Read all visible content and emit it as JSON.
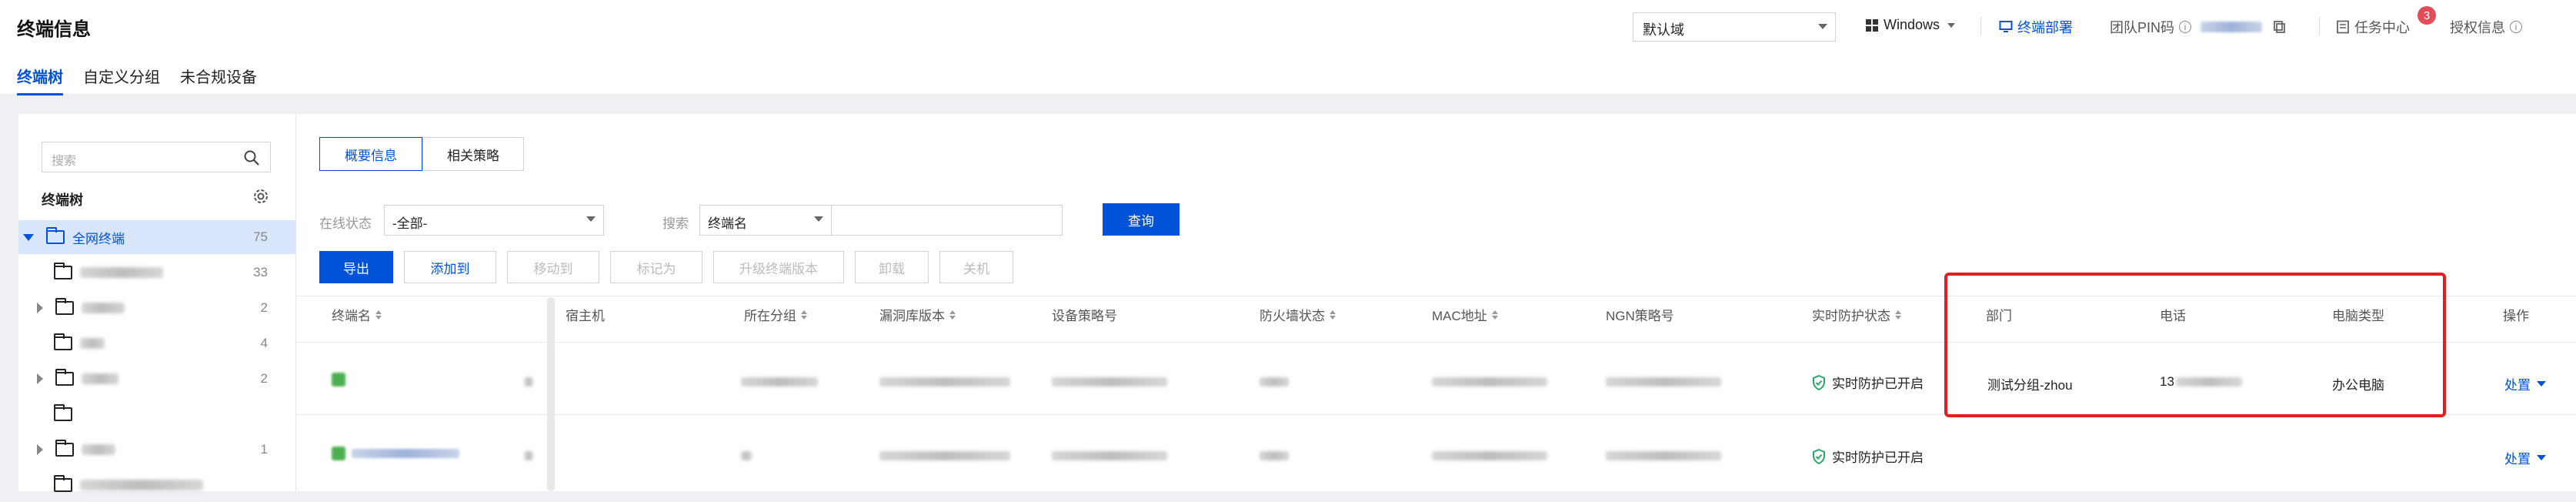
{
  "header": {
    "title": "终端信息",
    "tabs": [
      {
        "label": "终端树",
        "active": true
      },
      {
        "label": "自定义分组",
        "active": false
      },
      {
        "label": "未合规设备",
        "active": false
      }
    ],
    "domain_select": "默认域",
    "os_select": "Windows",
    "deploy": "终端部署",
    "team_pin_label": "团队PIN码",
    "task_center": "任务中心",
    "task_badge": "3",
    "license": "授权信息"
  },
  "sidebar": {
    "search_placeholder": "搜索",
    "tree_title": "终端树",
    "items": [
      {
        "label": "全网终端",
        "count": "75"
      },
      {
        "label": "",
        "count": "33"
      },
      {
        "label": "",
        "count": "2"
      },
      {
        "label": "",
        "count": "4"
      },
      {
        "label": "",
        "count": "2"
      },
      {
        "label": "",
        "count": ""
      },
      {
        "label": "",
        "count": "1"
      }
    ]
  },
  "main": {
    "segments": [
      "概要信息",
      "相关策略"
    ],
    "filter": {
      "status_label": "在线状态",
      "status_value": "-全部-",
      "search_label": "搜索",
      "search_field": "终端名",
      "query_button": "查询"
    },
    "actions": [
      "导出",
      "添加到",
      "移动到",
      "标记为",
      "升级终端版本",
      "卸载",
      "关机"
    ],
    "columns": [
      "终端名",
      "宿主机",
      "所在分组",
      "漏洞库版本",
      "设备策略号",
      "防火墙状态",
      "MAC地址",
      "NGN策略号",
      "实时防护状态",
      "部门",
      "电话",
      "电脑类型",
      "操作"
    ],
    "rows": [
      {
        "protection": "实时防护已开启",
        "department": "测试分组-zhou",
        "phone": "13",
        "pc_type": "办公电脑",
        "action": "处置"
      },
      {
        "protection": "实时防护已开启",
        "department": "",
        "phone": "",
        "pc_type": "",
        "action": "处置"
      }
    ]
  },
  "colors": {
    "accent": "#0052d9",
    "highlight_box": "#e02020",
    "success": "#2ba471"
  }
}
